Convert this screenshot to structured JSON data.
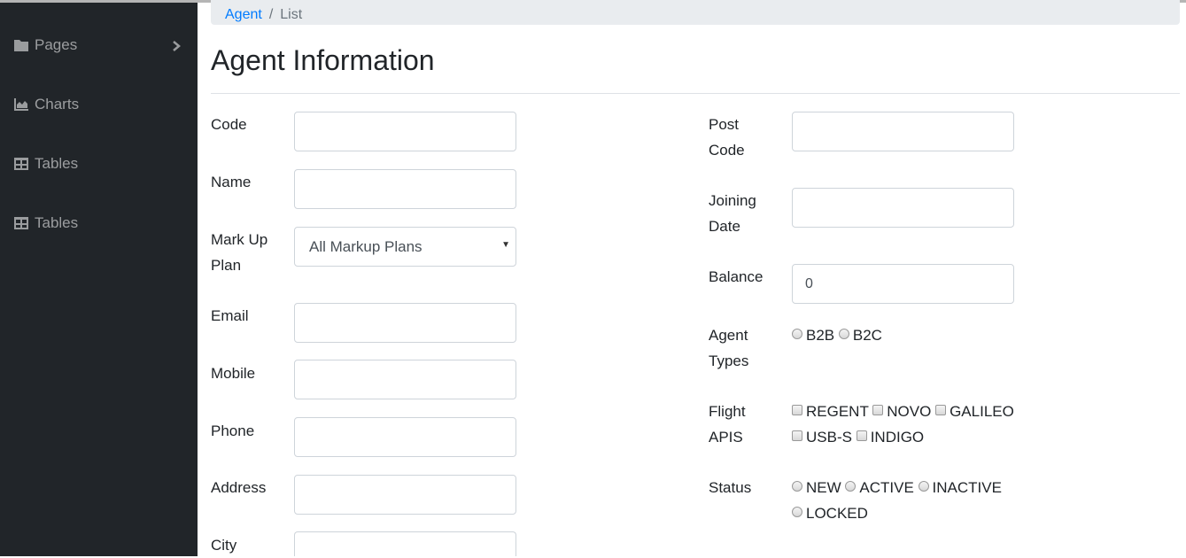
{
  "sidebar": {
    "items": [
      {
        "label": "Pages",
        "icon": "folder-icon"
      },
      {
        "label": "Charts",
        "icon": "area-chart-icon"
      },
      {
        "label": "Tables",
        "icon": "table-icon"
      },
      {
        "label": "Tables",
        "icon": "table-icon"
      }
    ]
  },
  "breadcrumb": {
    "link": "Agent",
    "separator": "/",
    "current": "List"
  },
  "page_title": "Agent Information",
  "form": {
    "code": {
      "label": "Code",
      "value": ""
    },
    "name": {
      "label": "Name",
      "value": ""
    },
    "markup_plan": {
      "label_line1": "Mark Up",
      "label_line2": "Plan",
      "selected": "All Markup Plans"
    },
    "email": {
      "label": "Email",
      "value": ""
    },
    "mobile": {
      "label": "Mobile",
      "value": ""
    },
    "phone": {
      "label": "Phone",
      "value": ""
    },
    "address": {
      "label": "Address",
      "value": ""
    },
    "city": {
      "label": "City",
      "value": ""
    },
    "post_code": {
      "label_line1": "Post",
      "label_line2": "Code",
      "value": ""
    },
    "joining_date": {
      "label_line1": "Joining",
      "label_line2": "Date",
      "value": ""
    },
    "balance": {
      "label": "Balance",
      "value": "0"
    },
    "agent_types": {
      "label_line1": "Agent",
      "label_line2": "Types",
      "options": [
        "B2B",
        "B2C"
      ]
    },
    "flight_apis": {
      "label_line1": "Flight",
      "label_line2": "APIS",
      "options": [
        "REGENT",
        "NOVO",
        "GALILEO",
        "USB-S",
        "INDIGO"
      ]
    },
    "status": {
      "label": "Status",
      "options": [
        "NEW",
        "ACTIVE",
        "INACTIVE",
        "LOCKED"
      ]
    }
  },
  "colors": {
    "sidebar_bg": "#212529",
    "link": "#007bff",
    "breadcrumb_bg": "#e9ecef"
  }
}
